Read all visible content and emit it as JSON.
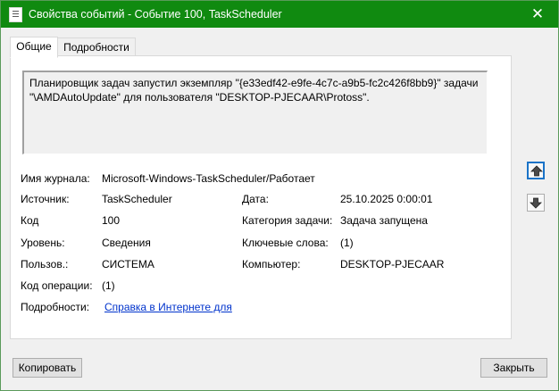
{
  "window": {
    "title": "Свойства событий - Событие 100, TaskScheduler",
    "close_glyph": "✕"
  },
  "tabs": [
    {
      "label": "Общие"
    },
    {
      "label": "Подробности"
    }
  ],
  "description": "Планировщик задач запустил экземпляр \"{e33edf42-e9fe-4c7c-a9b5-fc2c426f8bb9}\" задачи \"\\AMDAutoUpdate\" для пользователя \"DESKTOP-PJECAAR\\Protoss\".",
  "fields": {
    "log_name": {
      "label": "Имя журнала:",
      "value": "Microsoft-Windows-TaskScheduler/Работает"
    },
    "source": {
      "label": "Источник:",
      "value": "TaskScheduler"
    },
    "date": {
      "label": "Дата:",
      "value": "25.10.2025 0:00:01"
    },
    "code": {
      "label": "Код",
      "value": "100"
    },
    "category": {
      "label": "Категория задачи:",
      "value": "Задача запущена"
    },
    "level": {
      "label": "Уровень:",
      "value": "Сведения"
    },
    "keywords": {
      "label": "Ключевые слова:",
      "value": "(1)"
    },
    "user": {
      "label": "Пользов.:",
      "value": "СИСТЕМА"
    },
    "computer": {
      "label": "Компьютер:",
      "value": "DESKTOP-PJECAAR"
    },
    "opcode": {
      "label": "Код операции:",
      "value": "(1)"
    },
    "details": {
      "label": "Подробности:",
      "link": "Справка в Интернете для "
    }
  },
  "buttons": {
    "copy": "Копировать",
    "close": "Закрыть"
  },
  "icons": {
    "up": "arrow-up-icon",
    "down": "arrow-down-icon"
  },
  "colors": {
    "titlebar": "#108a10",
    "link": "#0033cc"
  }
}
